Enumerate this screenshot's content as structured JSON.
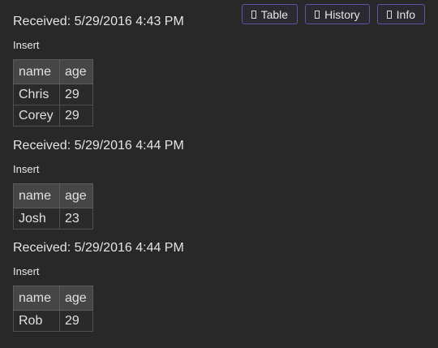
{
  "toolbar": {
    "table_label": "Table",
    "history_label": "History",
    "info_label": "Info"
  },
  "entries": [
    {
      "received": "Received: 5/29/2016 4:43 PM",
      "operation": "Insert",
      "columns": [
        "name",
        "age"
      ],
      "rows": [
        [
          "Chris",
          "29"
        ],
        [
          "Corey",
          "29"
        ]
      ]
    },
    {
      "received": "Received: 5/29/2016 4:44 PM",
      "operation": "Insert",
      "columns": [
        "name",
        "age"
      ],
      "rows": [
        [
          "Josh",
          "23"
        ]
      ]
    },
    {
      "received": "Received: 5/29/2016 4:44 PM",
      "operation": "Insert",
      "columns": [
        "name",
        "age"
      ],
      "rows": [
        [
          "Rob",
          "29"
        ]
      ]
    }
  ]
}
